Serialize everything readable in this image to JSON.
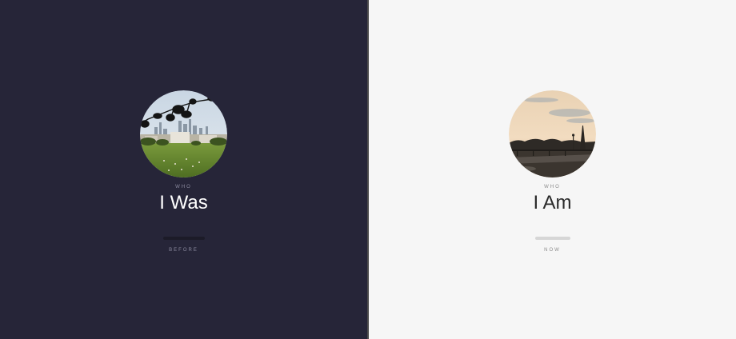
{
  "left_panel": {
    "kicker": "WHO",
    "title": "I Was",
    "subtitle": "BEFORE",
    "background": "#262538",
    "image_subject": "city-park-skyline-photo"
  },
  "right_panel": {
    "kicker": "WHO",
    "title": "I Am",
    "subtitle": "NOW",
    "background": "#f6f6f6",
    "image_subject": "paris-eiffel-tower-photo"
  }
}
